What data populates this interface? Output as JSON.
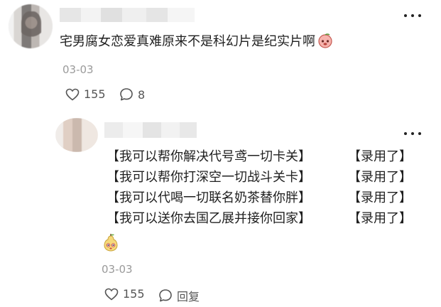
{
  "main_comment": {
    "text": "宅男腐女恋爱真难原来不是科幻片是纪实片啊",
    "emoji": "peach-face-emoji",
    "date": "03-03",
    "likes": "155",
    "comments": "8"
  },
  "reply": {
    "lines": [
      {
        "left": "【我可以帮你解决代号鸢一切卡关】",
        "right": "【录用了】"
      },
      {
        "left": "【我可以帮你打深空一切战斗关卡】",
        "right": "【录用了】"
      },
      {
        "left": "【我可以代喝一切联名奶茶替你胖】",
        "right": "【录用了】"
      },
      {
        "left": "【我可以送你去国乙展并接你回家】",
        "right": "【录用了】"
      }
    ],
    "emoji": "pear-face-emoji",
    "date": "03-03",
    "likes": "155",
    "reply_label": "回复"
  },
  "colors": {
    "text": "#1f1f1f",
    "muted": "#9a9a9a",
    "icon": "#555555"
  }
}
